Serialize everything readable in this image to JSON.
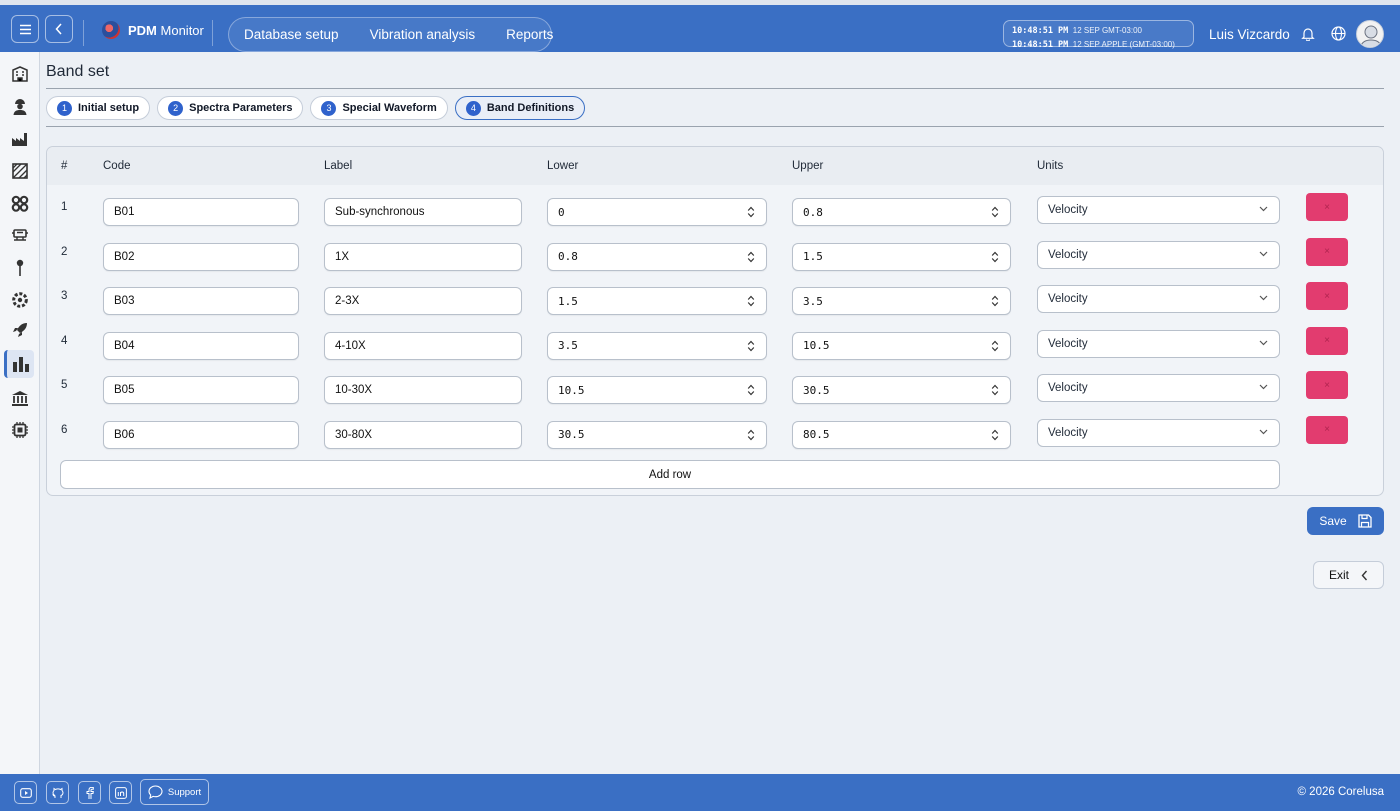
{
  "app": {
    "brand_strong": "PDM",
    "brand_rest": "Monitor"
  },
  "topnav": {
    "items": [
      "Database setup",
      "Vibration analysis",
      "Reports"
    ]
  },
  "clock": {
    "line1_time": "10:48:51 PM",
    "line1_date": "12 SEP  GMT-03:00",
    "line2_time": "10:48:51 PM",
    "line2_date": "12 SEP  APPLE (GMT-03:00)"
  },
  "user": {
    "name": "Luis Vizcardo"
  },
  "sidebar": {
    "icons": [
      "building-icon",
      "user-worker-icon",
      "factory-icon",
      "hatch-area-icon",
      "gears-icon",
      "machine-icon",
      "pin-icon",
      "gear-bolt-icon",
      "rocket-icon",
      "bar-chart-icon",
      "bank-icon",
      "chip-icon"
    ],
    "active_index": 9
  },
  "page": {
    "title": "Band set"
  },
  "steps": [
    {
      "num": "1",
      "label": "Initial setup"
    },
    {
      "num": "2",
      "label": "Spectra Parameters"
    },
    {
      "num": "3",
      "label": "Special Waveform"
    },
    {
      "num": "4",
      "label": "Band Definitions"
    }
  ],
  "active_step": 3,
  "table": {
    "headers": {
      "num": "#",
      "code": "Code",
      "label": "Label",
      "lower": "Lower",
      "upper": "Upper",
      "units": "Units"
    },
    "rows": [
      {
        "num": "1",
        "code": "B01",
        "label": "Sub-synchronous",
        "lower": "0",
        "upper": "0.8",
        "units": "Velocity"
      },
      {
        "num": "2",
        "code": "B02",
        "label": "1X",
        "lower": "0.8",
        "upper": "1.5",
        "units": "Velocity"
      },
      {
        "num": "3",
        "code": "B03",
        "label": "2-3X",
        "lower": "1.5",
        "upper": "3.5",
        "units": "Velocity"
      },
      {
        "num": "4",
        "code": "B04",
        "label": "4-10X",
        "lower": "3.5",
        "upper": "10.5",
        "units": "Velocity"
      },
      {
        "num": "5",
        "code": "B05",
        "label": "10-30X",
        "lower": "10.5",
        "upper": "30.5",
        "units": "Velocity"
      },
      {
        "num": "6",
        "code": "B06",
        "label": "30-80X",
        "lower": "30.5",
        "upper": "80.5",
        "units": "Velocity"
      }
    ],
    "delete_glyph": "×",
    "add_row_label": "Add row"
  },
  "actions": {
    "save_label": "Save",
    "exit_label": "Exit"
  },
  "footer": {
    "support_label": "Support",
    "copyright": "© 2026 Corelusa"
  },
  "colors": {
    "primary": "#3a6fc4",
    "danger": "#e23c6f",
    "step_num": "#2f62cc"
  }
}
